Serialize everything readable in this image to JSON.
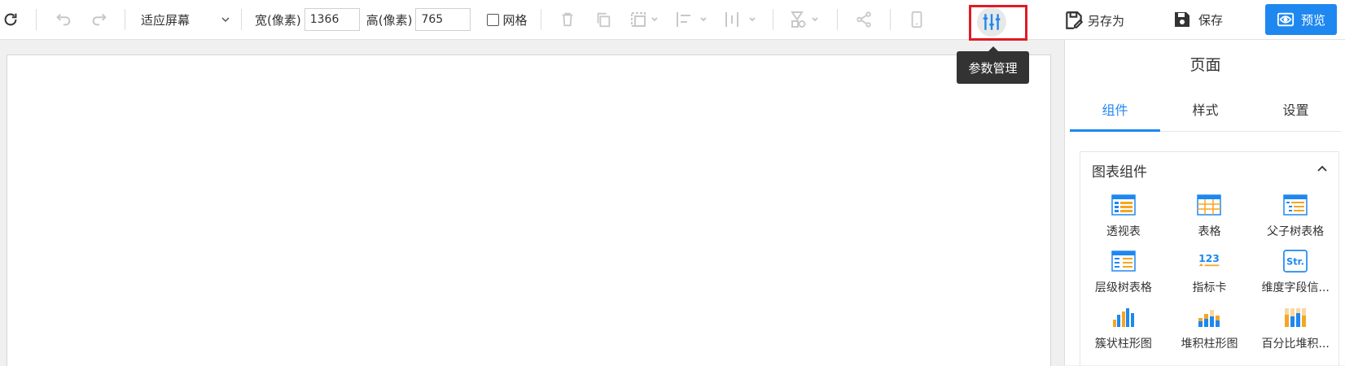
{
  "toolbar": {
    "fit_label": "适应屏幕",
    "width_label": "宽(像素)",
    "width_value": "1366",
    "height_label": "高(像素)",
    "height_value": "765",
    "grid_label": "网格",
    "save_as_label": "另存为",
    "save_label": "保存",
    "preview_label": "预览",
    "tooltip": "参数管理"
  },
  "panel": {
    "title": "页面",
    "tabs": [
      "组件",
      "样式",
      "设置"
    ],
    "section_title": "图表组件",
    "components": [
      {
        "label": "透视表",
        "icon": "pivot-table-icon"
      },
      {
        "label": "表格",
        "icon": "table-icon"
      },
      {
        "label": "父子树表格",
        "icon": "parent-child-tree-table-icon"
      },
      {
        "label": "层级树表格",
        "icon": "hierarchy-tree-table-icon"
      },
      {
        "label": "指标卡",
        "icon": "kpi-card-icon"
      },
      {
        "label": "维度字段信...",
        "icon": "dimension-field-icon"
      },
      {
        "label": "簇状柱形图",
        "icon": "clustered-bar-chart-icon"
      },
      {
        "label": "堆积柱形图",
        "icon": "stacked-bar-chart-icon"
      },
      {
        "label": "百分比堆积...",
        "icon": "percent-stacked-bar-chart-icon"
      }
    ]
  },
  "colors": {
    "accent": "#1e88f0",
    "highlight": "#e01b24",
    "orange": "#f5a623"
  }
}
